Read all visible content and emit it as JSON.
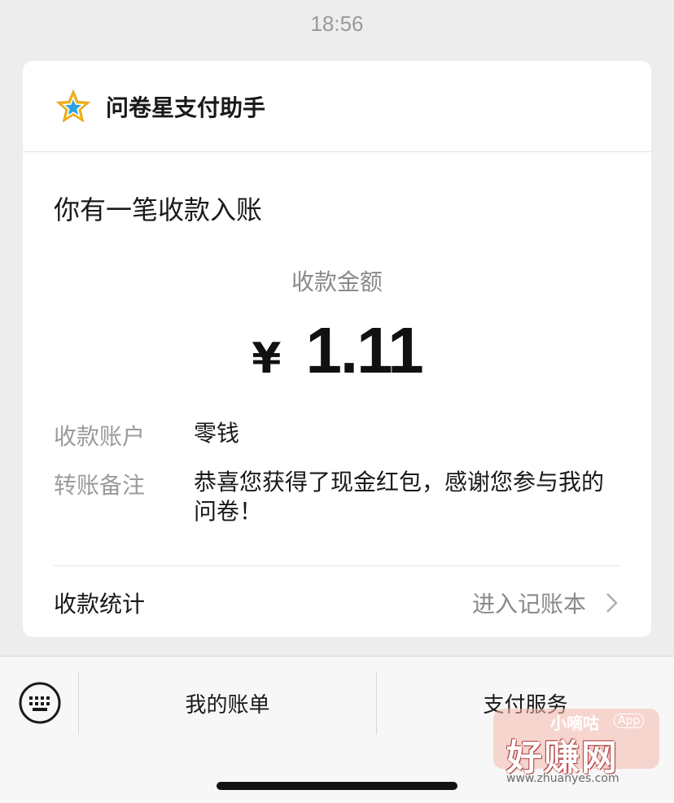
{
  "status_bar": {
    "time": "18:56"
  },
  "card": {
    "account_name": "问卷星支付助手",
    "headline": "你有一笔收款入账",
    "amount_label": "收款金额",
    "currency_symbol": "¥",
    "amount": "1.11",
    "details": [
      {
        "label": "收款账户",
        "value": "零钱"
      },
      {
        "label": "转账备注",
        "value": "恭喜您获得了现金红包，感谢您参与我的问卷！"
      }
    ],
    "stats_label": "收款统计",
    "stats_link": "进入记账本"
  },
  "bottom_menu": {
    "items": [
      {
        "label": "我的账单"
      },
      {
        "label": "支付服务"
      }
    ]
  },
  "watermark": {
    "top": "小嘀咕",
    "badge": "App",
    "main": "好赚网",
    "domain": "www.zhuanyes.com"
  },
  "colors": {
    "background": "#ededed",
    "card": "#ffffff",
    "star_outer": "#f2b418",
    "star_inner": "#2aa4e0"
  },
  "icons": [
    "star-logo-icon",
    "chevron-right-icon",
    "keyboard-icon"
  ]
}
